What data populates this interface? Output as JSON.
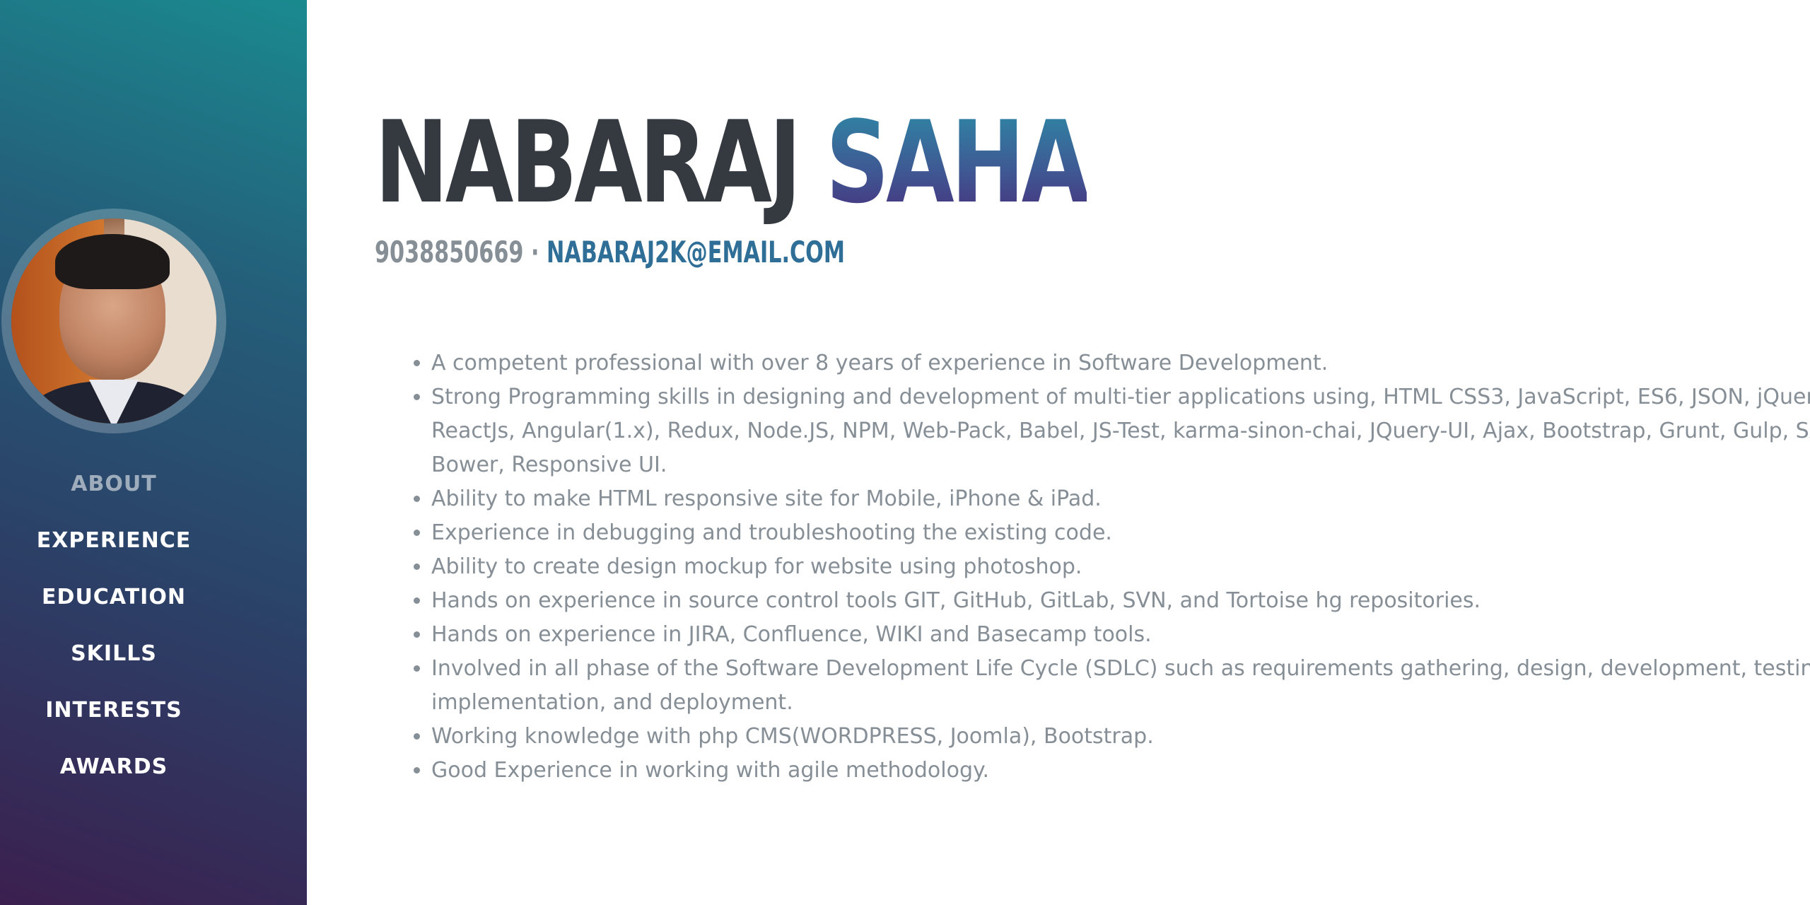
{
  "sidebar": {
    "nav": [
      {
        "label": "ABOUT"
      },
      {
        "label": "EXPERIENCE"
      },
      {
        "label": "EDUCATION"
      },
      {
        "label": "SKILLS"
      },
      {
        "label": "INTERESTS"
      },
      {
        "label": "AWARDS"
      }
    ],
    "active": "ABOUT"
  },
  "header": {
    "first_name": "NABARAJ",
    "last_name": "SAHA",
    "phone": "9038850669",
    "separator": "·",
    "email": "NABARAJ2K@EMAIL.COM"
  },
  "about": {
    "bullets": [
      "A competent professional with over 8 years of experience in Software Development.",
      "Strong Programming skills in designing and development of multi-tier applications using, HTML CSS3, JavaScript, ES6, JSON, jQuery, ReactJs, Angular(1.x), Redux, Node.JS, NPM, Web-Pack, Babel, JS-Test, karma-sinon-chai, JQuery-UI, Ajax, Bootstrap, Grunt, Gulp, SASS, Bower, Responsive UI.",
      "Ability to make HTML responsive site for Mobile, iPhone & iPad.",
      "Experience in debugging and troubleshooting the existing code.",
      "Ability to create design mockup for website using photoshop.",
      "Hands on experience in source control tools GIT, GitHub, GitLab, SVN, and Tortoise hg repositories.",
      "Hands on experience in JIRA, Confluence, WIKI and Basecamp tools.",
      "Involved in all phase of the Software Development Life Cycle (SDLC) such as requirements gathering, design, development, testing, implementation, and deployment.",
      "Working knowledge with php CMS(WORDPRESS, Joomla), Bootstrap.",
      "Good Experience in working with agile methodology."
    ]
  },
  "colors": {
    "sidebar_top": "#1a8a8f",
    "sidebar_bottom": "#3b1f4f",
    "name_dark": "#343a40",
    "accent": "#2f6e96",
    "body_text": "#868e96"
  }
}
